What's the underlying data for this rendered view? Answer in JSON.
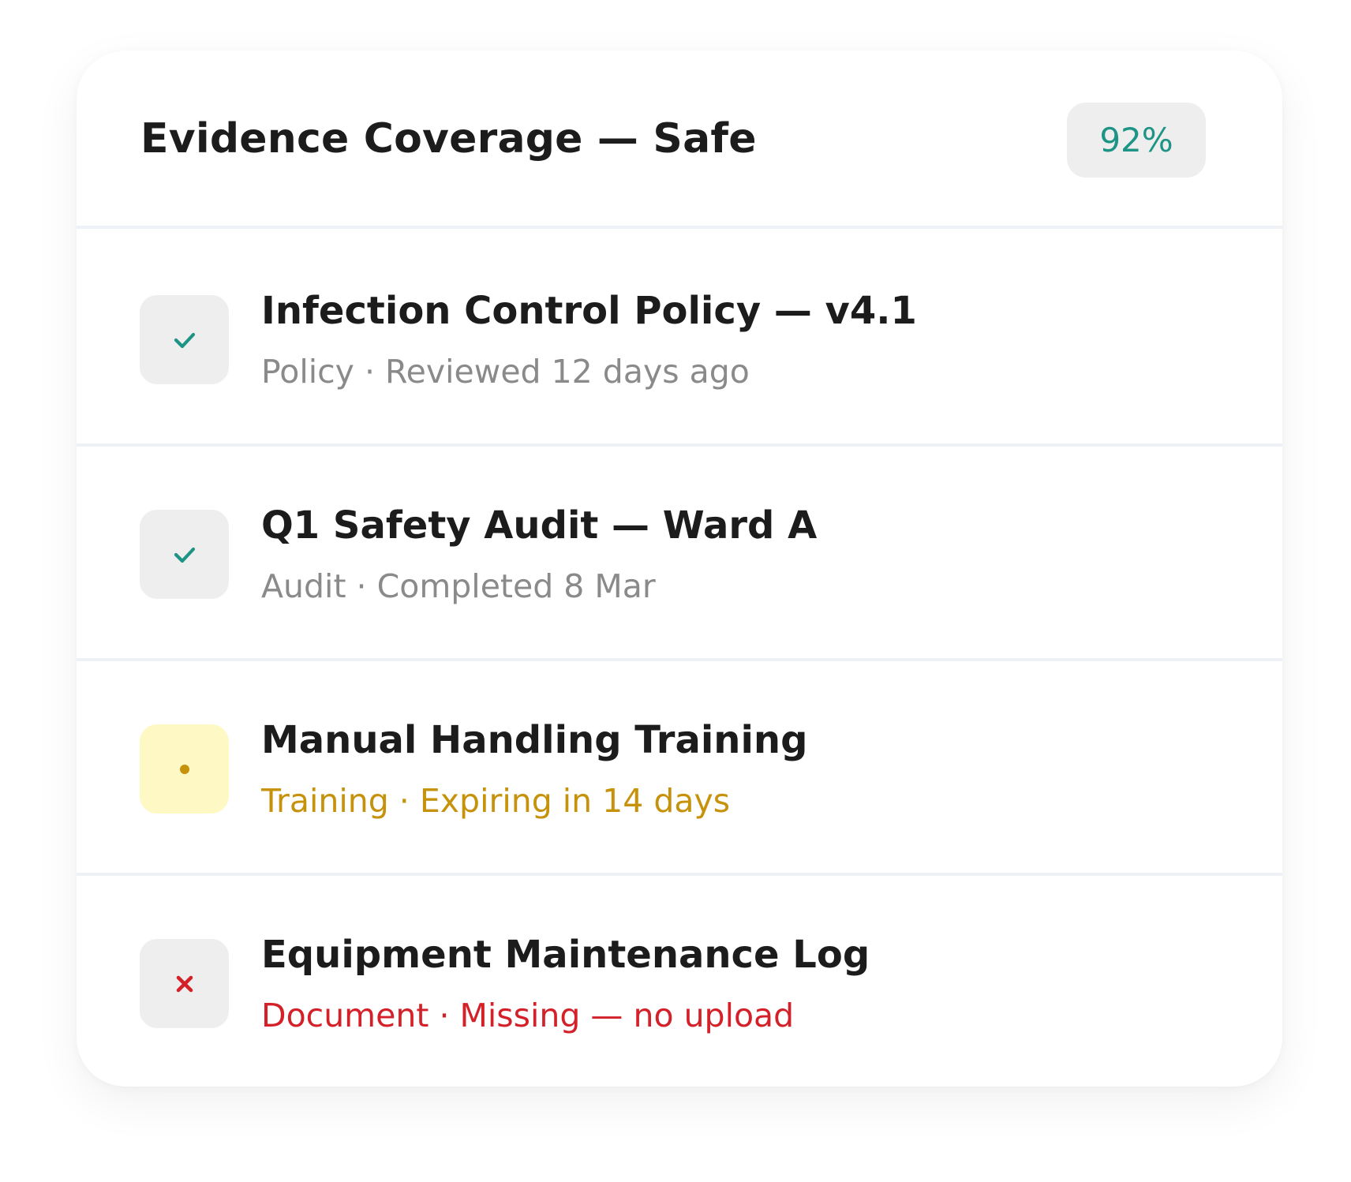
{
  "card": {
    "title": "Evidence Coverage — Safe",
    "coverage_percent": "92%"
  },
  "colors": {
    "ok": "#1d9486",
    "warning": "#c6920b",
    "warning_bg": "#fef8c5",
    "error": "#d42129",
    "neutral_bg": "#eeeeee"
  },
  "items": [
    {
      "title": "Infection Control Policy — v4.1",
      "meta": "Policy · Reviewed 12 days ago",
      "status": "complete",
      "icon": "check-icon"
    },
    {
      "title": "Q1 Safety Audit — Ward A",
      "meta": "Audit · Completed 8 Mar",
      "status": "complete",
      "icon": "check-icon"
    },
    {
      "title": "Manual Handling Training",
      "meta": "Training · Expiring in 14 days",
      "status": "expiring",
      "icon": "dot-icon"
    },
    {
      "title": "Equipment Maintenance Log",
      "meta": "Document · Missing — no upload",
      "status": "missing",
      "icon": "cross-icon"
    }
  ]
}
